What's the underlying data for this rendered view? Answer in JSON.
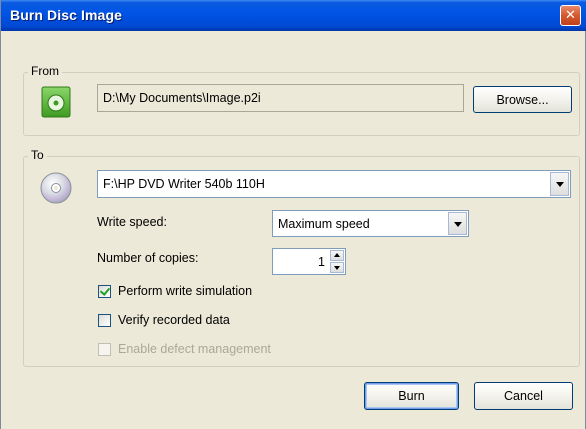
{
  "window": {
    "title": "Burn Disc Image",
    "close_glyph": "✕"
  },
  "from": {
    "label": "From",
    "icon": "disc-image-icon",
    "path": "D:\\My Documents\\Image.p2i",
    "browse_label": "Browse..."
  },
  "to": {
    "label": "To",
    "icon": "cd-drive-icon",
    "drive": "F:\\HP DVD Writer 540b 110H",
    "write_speed_label": "Write speed:",
    "write_speed_value": "Maximum speed",
    "copies_label": "Number of copies:",
    "copies_value": "1",
    "options": [
      {
        "label": "Perform write simulation",
        "checked": true,
        "disabled": false
      },
      {
        "label": "Verify recorded data",
        "checked": false,
        "disabled": false
      },
      {
        "label": "Enable defect management",
        "checked": false,
        "disabled": true
      }
    ]
  },
  "actions": {
    "burn_label": "Burn",
    "cancel_label": "Cancel"
  },
  "colors": {
    "titlebar": "#0055e5",
    "dialog_bg": "#ece9d8",
    "close": "#d45a2e",
    "accent_green": "#5cb830"
  }
}
